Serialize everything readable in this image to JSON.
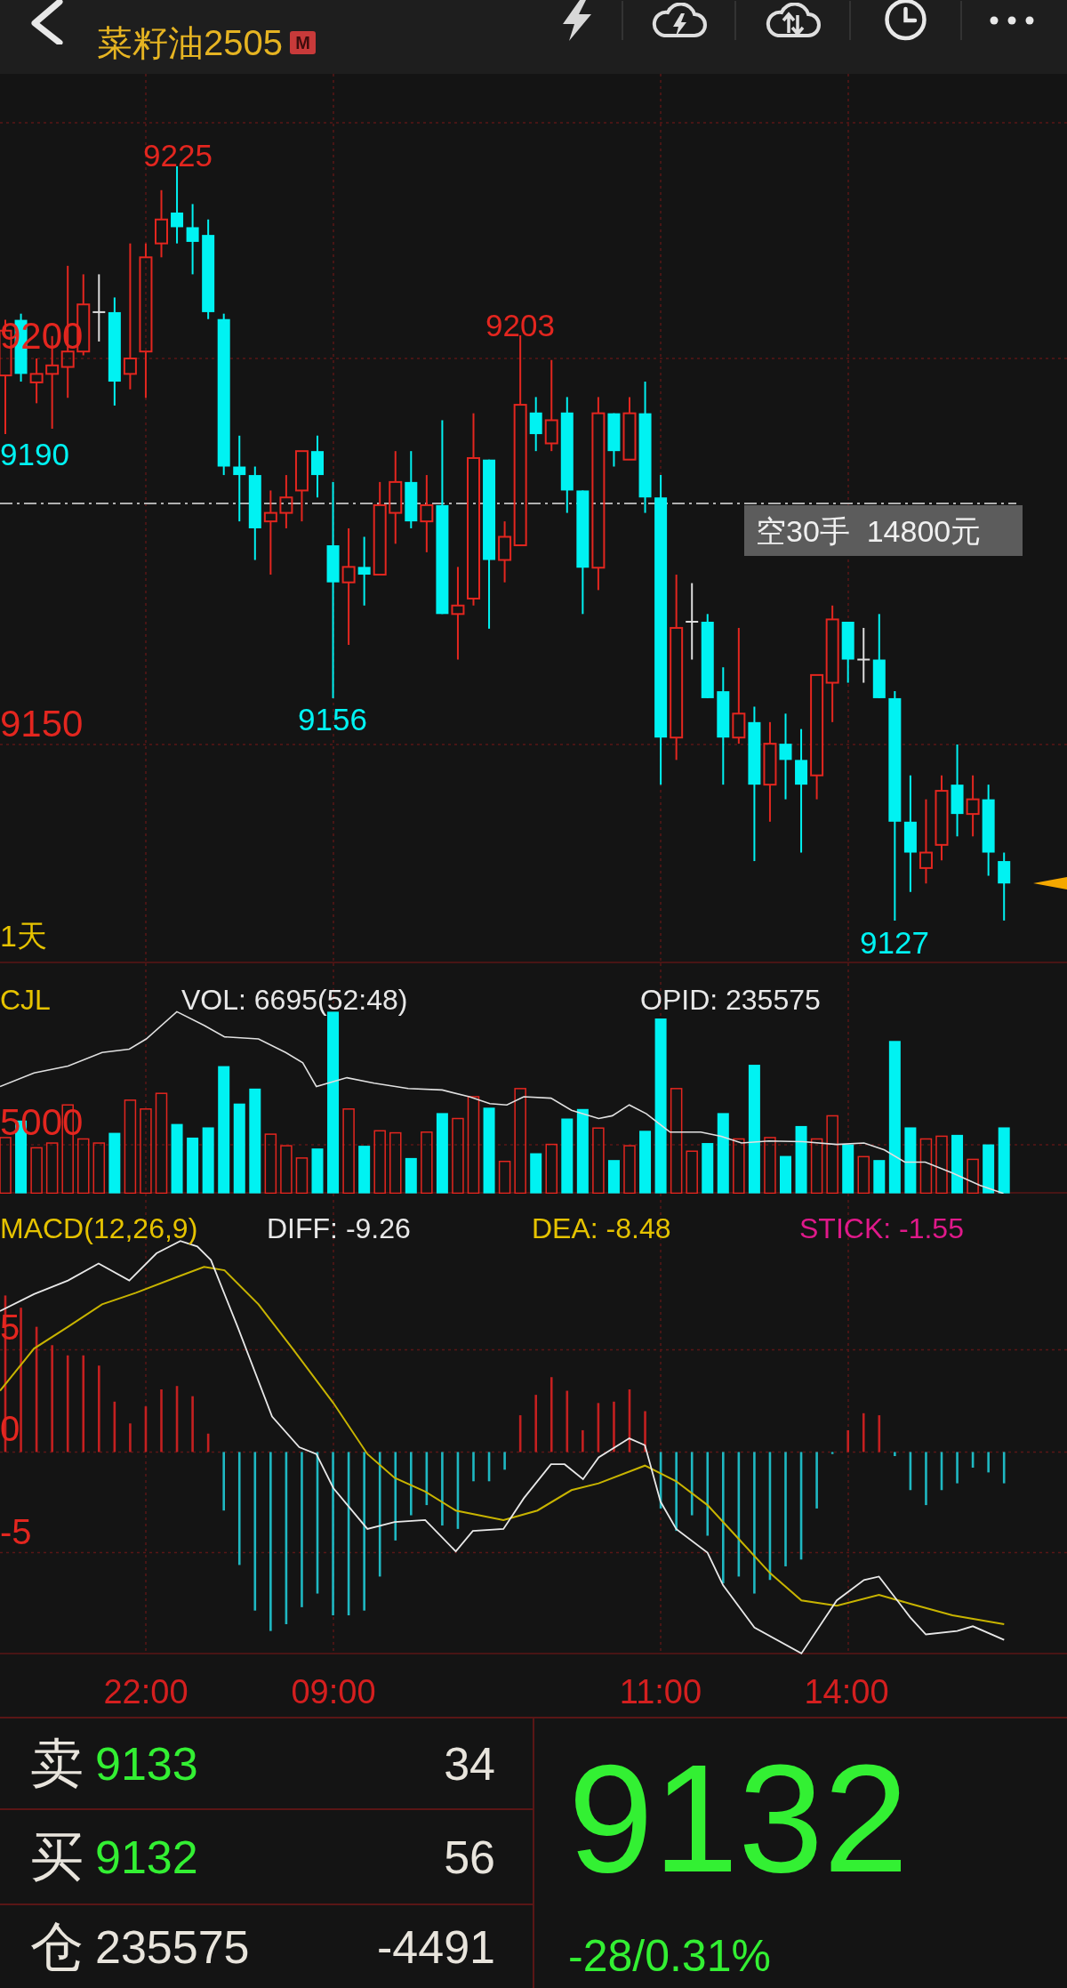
{
  "header": {
    "title": "菜籽油2505",
    "badge": "M"
  },
  "price_chart": {
    "axis_labels": [
      "9200",
      "9150"
    ],
    "extremes": [
      {
        "text": "9225",
        "kind": "high"
      },
      {
        "text": "9203",
        "kind": "high"
      },
      {
        "text": "9190",
        "kind": "low"
      },
      {
        "text": "9156",
        "kind": "low"
      },
      {
        "text": "9127",
        "kind": "low"
      }
    ],
    "period": "1天",
    "position_tag": "空30手  14800元"
  },
  "volume_chart": {
    "legend": [
      {
        "text": "CJL",
        "kind": "name"
      },
      {
        "text": "VOL: 6695(52:48)",
        "kind": "value"
      },
      {
        "text": "OPID: 235575",
        "kind": "value"
      }
    ],
    "axis_label": "5000"
  },
  "macd_chart": {
    "legend": [
      {
        "text": "MACD(12,26,9)",
        "color": "#e6c300"
      },
      {
        "text": "DIFF: -9.26",
        "color": "#e8e8e8"
      },
      {
        "text": "DEA: -8.48",
        "color": "#e6c300"
      },
      {
        "text": "STICK: -1.55",
        "color": "#e0198a"
      }
    ],
    "axis_labels": [
      "5",
      "0",
      "-5"
    ]
  },
  "time_axis": [
    "22:00",
    "09:00",
    "11:00",
    "14:00"
  ],
  "quote": {
    "rows": [
      {
        "kind": "ask",
        "label": "卖",
        "price": "9133",
        "volume": "34"
      },
      {
        "kind": "bid",
        "label": "买",
        "price": "9132",
        "volume": "56"
      },
      {
        "kind": "open_interest",
        "label": "仓",
        "price": "235575",
        "volume": "-4491"
      }
    ],
    "last_price": "9132",
    "change": "-28/0.31%",
    "falling": true
  }
}
